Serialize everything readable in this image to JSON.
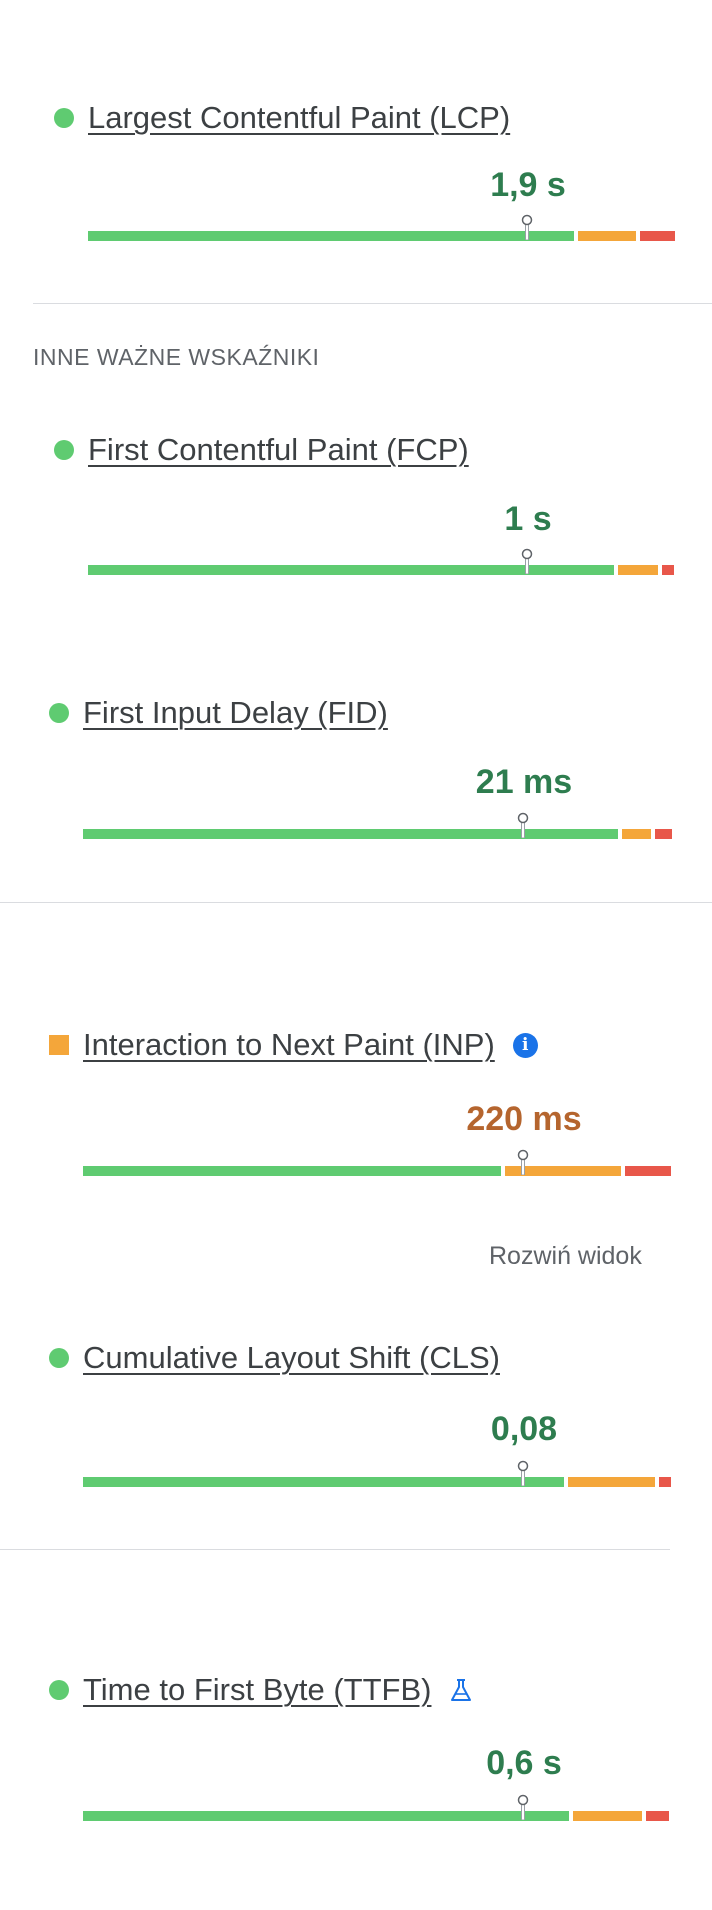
{
  "colors": {
    "good": "#5fcb71",
    "needs_improvement": "#f4a63a",
    "poor": "#e8574a",
    "value_good": "#2e7d4f",
    "value_ni": "#b5652e",
    "info_blue": "#1a73e8"
  },
  "lcp": {
    "label": "Largest Contentful Paint (LCP)",
    "value": "1,9 s",
    "status": "good",
    "distribution": {
      "good": 0.84,
      "needs_improvement": 0.1,
      "poor": 0.06
    }
  },
  "other_metrics_heading": "INNE WAŻNE WSKAŹNIKI",
  "fcp": {
    "label": "First Contentful Paint (FCP)",
    "value": "1 s",
    "status": "good",
    "distribution": {
      "good": 0.91,
      "needs_improvement": 0.07,
      "poor": 0.02
    }
  },
  "fid": {
    "label": "First Input Delay (FID)",
    "value": "21 ms",
    "status": "good",
    "distribution": {
      "good": 0.92,
      "needs_improvement": 0.05,
      "poor": 0.03
    }
  },
  "inp": {
    "label": "Interaction to Next Paint (INP)",
    "value": "220 ms",
    "status": "needs_improvement",
    "info_icon": "info-icon",
    "distribution": {
      "good": 0.72,
      "needs_improvement": 0.2,
      "poor": 0.08
    }
  },
  "expand_view_label": "Rozwiń widok",
  "cls": {
    "label": "Cumulative Layout Shift (CLS)",
    "value": "0,08",
    "status": "good",
    "distribution": {
      "good": 0.83,
      "needs_improvement": 0.15,
      "poor": 0.02
    }
  },
  "ttfb": {
    "label": "Time to First Byte (TTFB)",
    "value": "0,6 s",
    "status": "good",
    "lab_icon": "flask-icon",
    "distribution": {
      "good": 0.84,
      "needs_improvement": 0.12,
      "poor": 0.04
    }
  }
}
